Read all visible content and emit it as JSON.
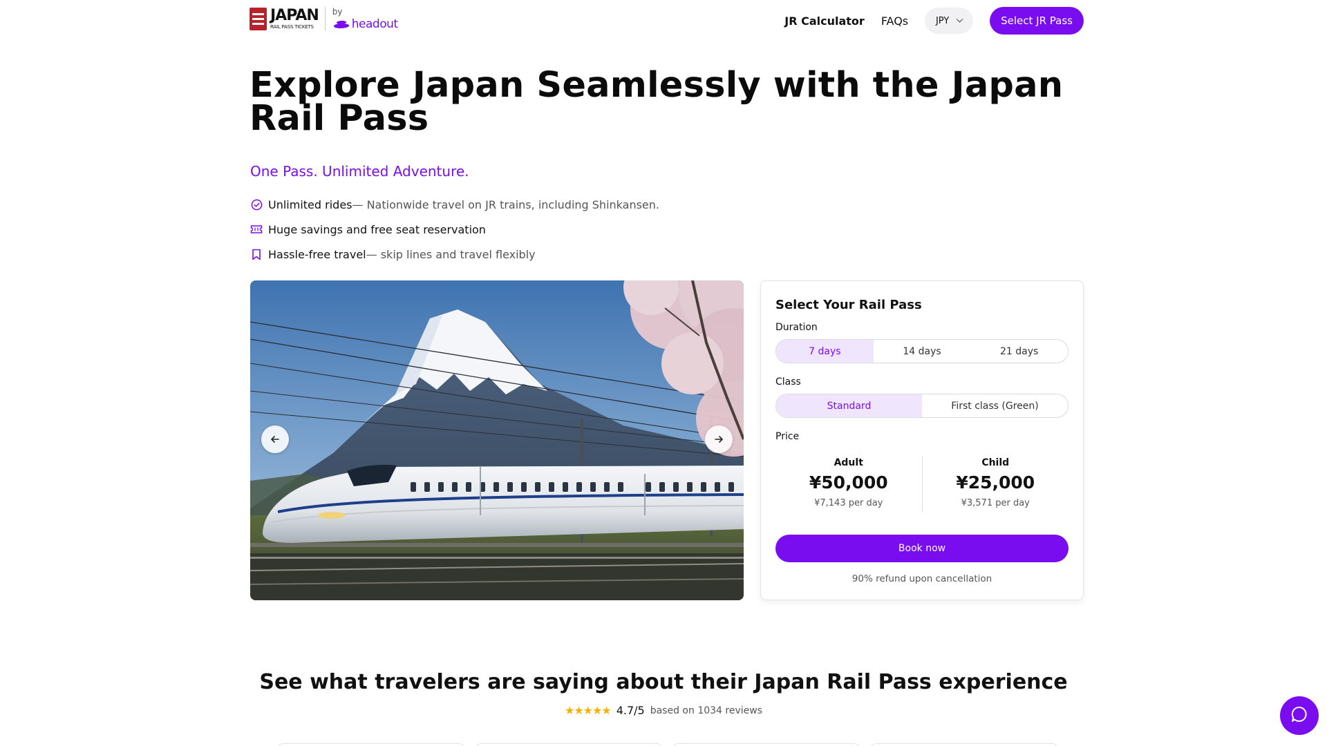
{
  "header": {
    "logo_main": "JAPAN",
    "logo_sub": "RAIL PASS TICKETS",
    "by_label": "by",
    "partner_name": "headout",
    "nav_calculator": "JR Calculator",
    "nav_faqs": "FAQs",
    "currency": "JPY",
    "cta_label": "Select JR Pass"
  },
  "hero": {
    "title": "Explore Japan Seamlessly with the Japan Rail Pass",
    "tagline": "One Pass. Unlimited Adventure.",
    "features": [
      {
        "icon": "check-circle-icon",
        "strong": "Unlimited rides",
        "rest": " — Nationwide travel on JR trains, including Shinkansen."
      },
      {
        "icon": "ticket-icon",
        "strong": "Huge savings and free seat reservation",
        "rest": ""
      },
      {
        "icon": "bookmark-icon",
        "strong": "Hassle-free travel",
        "rest": " — skip lines and travel flexibly"
      }
    ]
  },
  "carousel": {
    "image_subject": "shinkansen-mount-fuji-cherry-blossom",
    "prev_icon": "arrow-left-icon",
    "next_icon": "arrow-right-icon"
  },
  "booking": {
    "title": "Select Your Rail Pass",
    "duration_label": "Duration",
    "duration_options": [
      "7 days",
      "14 days",
      "21 days"
    ],
    "duration_selected": "7 days",
    "class_label": "Class",
    "class_options": [
      "Standard",
      "First class (Green)"
    ],
    "class_selected": "Standard",
    "price_label": "Price",
    "adult": {
      "label": "Adult",
      "price": "¥50,000",
      "per_day": "¥7,143 per day"
    },
    "child": {
      "label": "Child",
      "price": "¥25,000",
      "per_day": "¥3,571 per day"
    },
    "book_label": "Book now",
    "refund_note": "90% refund upon cancellation"
  },
  "reviews": {
    "title": "See what travelers are saying about their Japan Rail Pass experience",
    "stars": "★★★★★",
    "score": "4.7/5",
    "based_on": "based on 1034 reviews"
  },
  "colors": {
    "brand": "#7a0df0",
    "brand_light": "#efe5fd",
    "logo_red": "#b8232b",
    "star": "#f5b301"
  },
  "chat": {
    "icon": "chat-bubble-icon"
  }
}
